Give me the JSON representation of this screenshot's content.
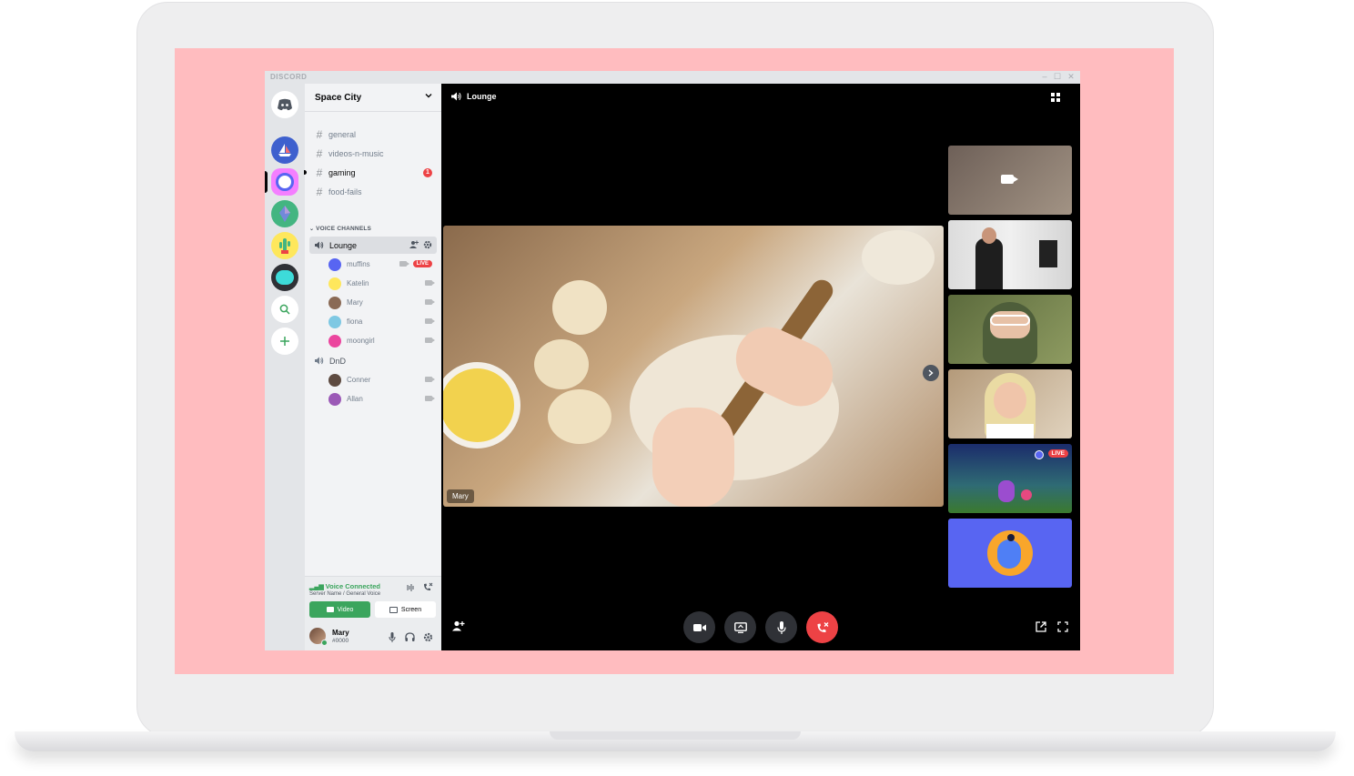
{
  "app": {
    "brand": "DISCORD",
    "window_controls": [
      "–",
      "☐",
      "✕"
    ]
  },
  "server": {
    "name": "Space City"
  },
  "text_channels": [
    {
      "name": "general",
      "unread": false
    },
    {
      "name": "videos-n-music",
      "unread": false
    },
    {
      "name": "gaming",
      "unread": true,
      "mentions": "1"
    },
    {
      "name": "food-fails",
      "unread": false
    }
  ],
  "voice_category": "VOICE CHANNELS",
  "voice_channels": [
    {
      "name": "Lounge",
      "active": true,
      "users": [
        {
          "name": "muffins",
          "live": true,
          "live_label": "LIVE",
          "avatar_color": "#5865f2"
        },
        {
          "name": "Katelin",
          "avatar_color": "#fee75c"
        },
        {
          "name": "Mary",
          "avatar_color": "#8a6a55"
        },
        {
          "name": "fiona",
          "avatar_color": "#7ec8e3"
        },
        {
          "name": "moongirl",
          "avatar_color": "#eb459e"
        }
      ]
    },
    {
      "name": "DnD",
      "active": false,
      "users": [
        {
          "name": "Conner",
          "avatar_color": "#5d4a40"
        },
        {
          "name": "Allan",
          "avatar_color": "#9b59b6"
        }
      ]
    }
  ],
  "voice_panel": {
    "status": "Voice Connected",
    "server": "Server Name / General Voice",
    "video_label": "Video",
    "screen_label": "Screen"
  },
  "user": {
    "name": "Mary",
    "tag": "#0000"
  },
  "call": {
    "channel": "Lounge",
    "focused_user": "Mary",
    "side_live_label": "LIVE"
  },
  "colors": {
    "blurple": "#5865f2",
    "green": "#3ba55d",
    "red": "#ed4245",
    "background_pink": "#ffbcbf"
  },
  "icons": [
    "discord-logo-icon",
    "speaker-icon",
    "grid-icon",
    "camera-icon",
    "screen-share-icon",
    "microphone-icon",
    "hang-up-icon",
    "add-user-icon",
    "popout-icon",
    "fullscreen-icon",
    "gear-icon",
    "headphones-icon",
    "search-icon",
    "plus-icon"
  ]
}
